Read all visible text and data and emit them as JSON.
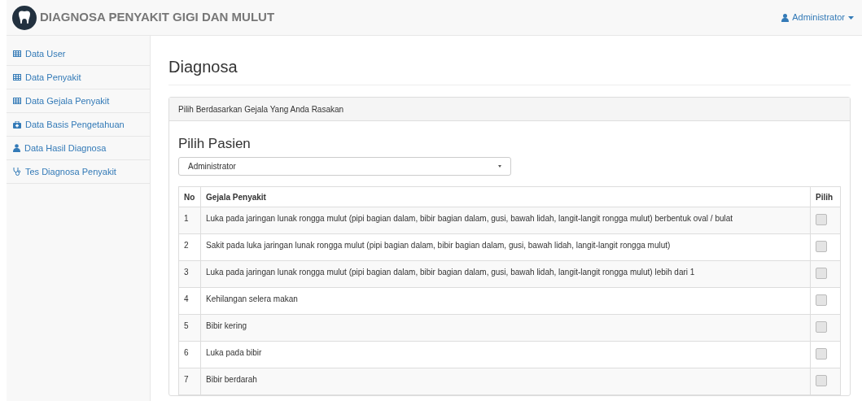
{
  "navbar": {
    "brand": "DIAGNOSA PENYAKIT GIGI DAN MULUT",
    "user_menu": "Administrator"
  },
  "sidebar": {
    "items": [
      {
        "label": "Data User",
        "kind": "table"
      },
      {
        "label": "Data Penyakit",
        "kind": "table"
      },
      {
        "label": "Data Gejala Penyakit",
        "kind": "table"
      },
      {
        "label": "Data Basis Pengetahuan",
        "kind": "kit"
      },
      {
        "label": "Data Hasil Diagnosa",
        "kind": "doctor"
      },
      {
        "label": "Tes Diagnosa Penyakit",
        "kind": "stethoscope"
      }
    ]
  },
  "page": {
    "title": "Diagnosa",
    "panel": {
      "heading": "Pilih Berdasarkan Gejala Yang Anda Rasakan",
      "subtitle": "Pilih Pasien",
      "patient_select": {
        "value": "Administrator"
      },
      "table": {
        "columns": [
          "No",
          "Gejala Penyakit",
          "Pilih"
        ],
        "rows": [
          {
            "no": "1",
            "symptom": "Luka pada jaringan lunak rongga mulut (pipi bagian dalam, bibir bagian dalam, gusi, bawah lidah, langit-langit rongga mulut) berbentuk oval / bulat",
            "checked": false
          },
          {
            "no": "2",
            "symptom": "Sakit pada luka jaringan lunak rongga mulut (pipi bagian dalam, bibir bagian dalam, gusi, bawah lidah, langit-langit rongga mulut)",
            "checked": false
          },
          {
            "no": "3",
            "symptom": "Luka pada jaringan lunak rongga mulut (pipi bagian dalam, bibir bagian dalam, gusi, bawah lidah, langit-langit rongga mulut) lebih dari 1",
            "checked": false
          },
          {
            "no": "4",
            "symptom": "Kehilangan selera makan",
            "checked": false
          },
          {
            "no": "5",
            "symptom": "Bibir kering",
            "checked": false
          },
          {
            "no": "6",
            "symptom": "Luka pada bibir",
            "checked": false
          },
          {
            "no": "7",
            "symptom": "Bibir berdarah",
            "checked": false
          }
        ]
      }
    }
  }
}
